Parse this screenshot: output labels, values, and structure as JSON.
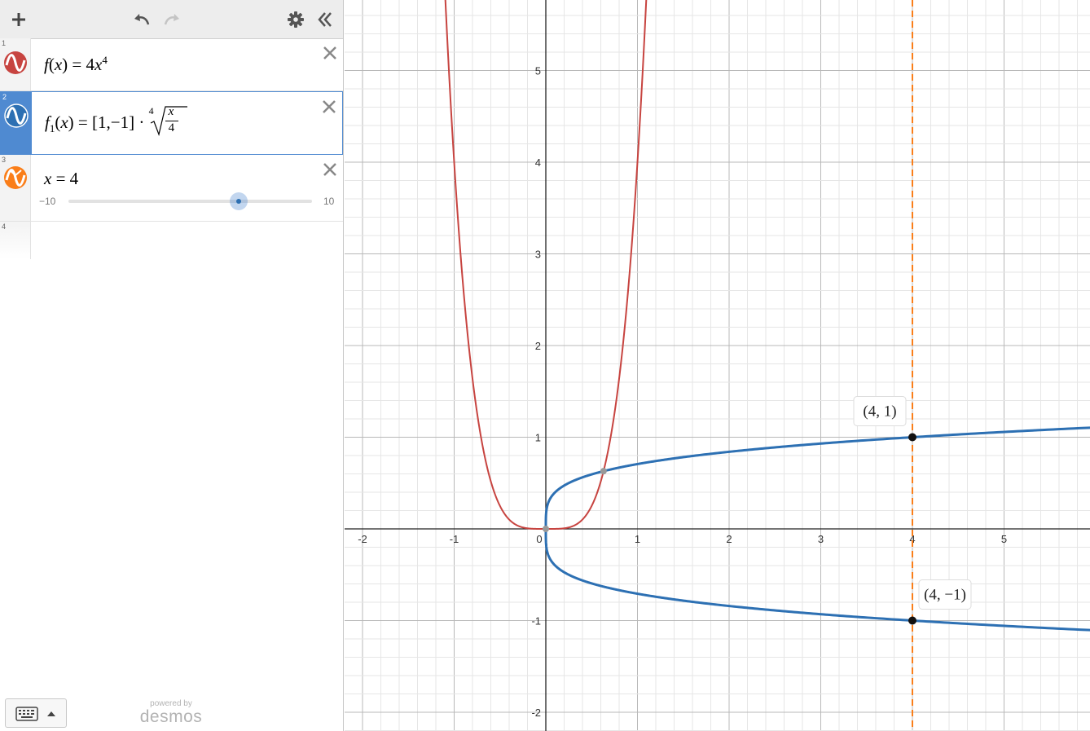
{
  "toolbar": {
    "add": "add-expression",
    "undo": "undo",
    "redo": "redo",
    "settings": "graph-settings",
    "collapse": "hide-expression-list"
  },
  "expressions": [
    {
      "index": "1",
      "color": "#c74440",
      "fname": "f",
      "arg": "x",
      "rhs_coef": "4",
      "rhs_var": "x",
      "rhs_exp": "4"
    },
    {
      "index": "2",
      "color": "#2d70b3",
      "fname": "f",
      "sub": "1",
      "arg": "x",
      "list": "[1,−1]",
      "root_index": "4",
      "frac_num": "x",
      "frac_den": "4"
    },
    {
      "index": "3",
      "color": "#fa7e19",
      "var": "x",
      "value": "4",
      "slider_min": "−10",
      "slider_max": "10",
      "slider_value": 4
    },
    {
      "index": "4"
    }
  ],
  "footer": {
    "powered_by": "powered by",
    "brand": "desmos"
  },
  "graph": {
    "x_ticks": [
      "-2",
      "-1",
      "0",
      "1",
      "2",
      "3",
      "4",
      "5"
    ],
    "y_ticks": [
      "-2",
      "-1",
      "1",
      "2",
      "3",
      "4",
      "5"
    ],
    "points": [
      {
        "label": "(4, 1)"
      },
      {
        "label": "(4, −1)"
      }
    ],
    "colors": {
      "red": "#c74440",
      "blue": "#2d70b3",
      "orange": "#fa7e19"
    }
  }
}
